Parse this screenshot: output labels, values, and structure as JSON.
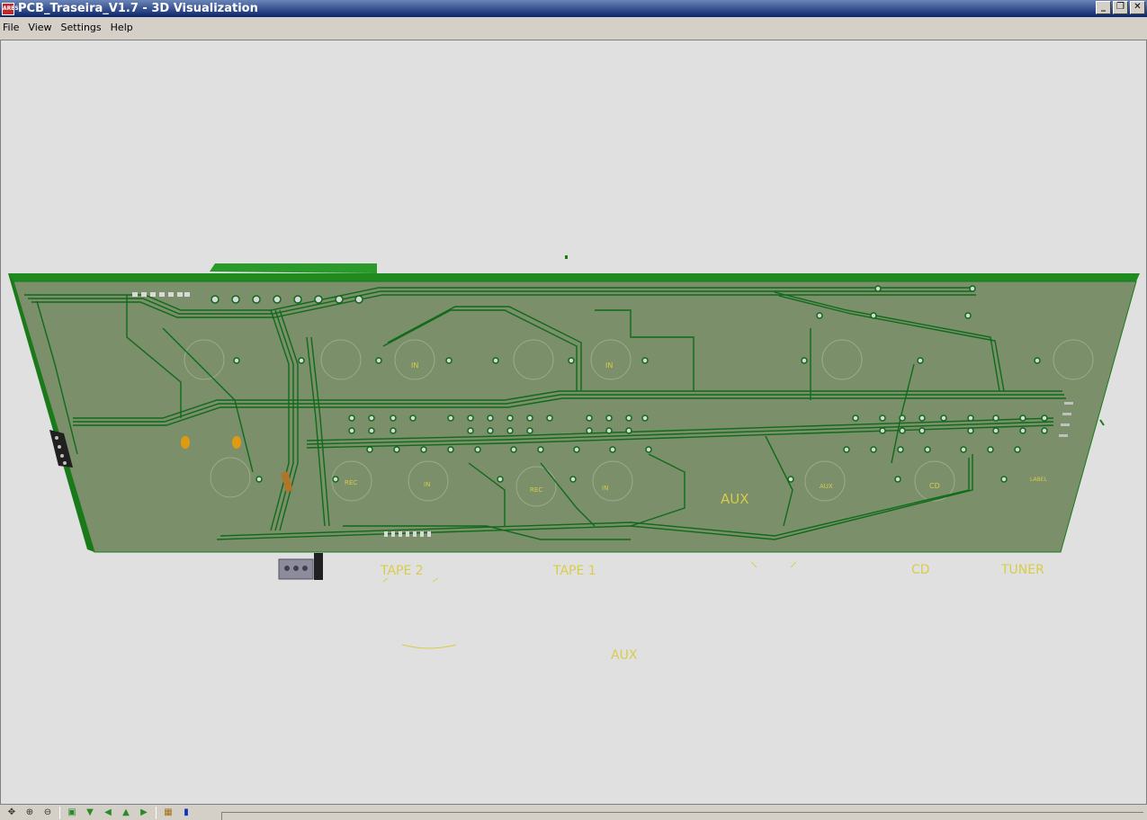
{
  "window": {
    "title": "PCB_Traseira_V1.7 - 3D Visualization",
    "icon_text": "ARES",
    "minimize_glyph": "_",
    "restore_glyph": "❐",
    "close_glyph": "✕"
  },
  "menu": {
    "items": [
      "File",
      "View",
      "Settings",
      "Help"
    ]
  },
  "board": {
    "silkscreen": {
      "in_left": "IN",
      "in_right": "IN",
      "rec_left": "REC",
      "in_lower": "IN",
      "rec_mid": "REC",
      "in_mid": "IN",
      "aux_large": "AUX",
      "aux_small": "AUX",
      "cd_board": "CD",
      "label_right": "LABEL"
    },
    "floating_labels": {
      "tape2": "TAPE 2",
      "tape1": "TAPE 1",
      "cd": "CD",
      "tuner": "TUNER",
      "aux": "AUX"
    },
    "colors": {
      "background": "#e0e0e0",
      "board_face": "#7a8f6a",
      "board_edge": "#1f8a1f",
      "traces": "#0f6a1a",
      "silkscreen": "#d8cc4a",
      "capacitor": "#e09a10"
    }
  },
  "toolbar": {
    "icons": [
      "move-icon",
      "zoom-in-icon",
      "zoom-out-icon",
      "view-top-icon",
      "view-front-icon",
      "view-left-icon",
      "view-back-icon",
      "view-right-icon",
      "view-bottom-icon",
      "render-mode-icon",
      "light-icon"
    ]
  }
}
